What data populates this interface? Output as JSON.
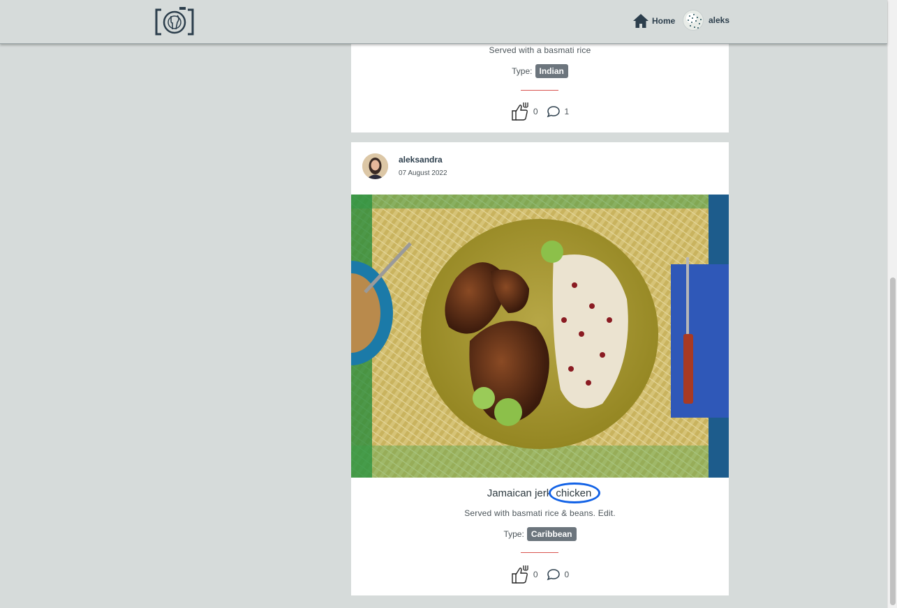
{
  "navbar": {
    "home_label": "Home",
    "username": "aleks",
    "icons": [
      "camera-plate-logo",
      "home-icon",
      "user-avatar"
    ]
  },
  "posts": [
    {
      "description": "Served with a basmati rice",
      "type_label": "Type:",
      "type_value": "Indian",
      "likes": "0",
      "comments": "1"
    },
    {
      "author": "aleksandra",
      "date": "07 August 2022",
      "title_prefix": "Jamaican jerk",
      "title_highlight": "chicken",
      "description": "Served with basmati rice & beans. Edit.",
      "type_label": "Type:",
      "type_value": "Caribbean",
      "likes": "0",
      "comments": "0"
    }
  ],
  "colors": {
    "background": "#d6dbda",
    "badge": "#6c757d",
    "divider": "#d9534f",
    "highlight_ring": "#1262e6"
  }
}
